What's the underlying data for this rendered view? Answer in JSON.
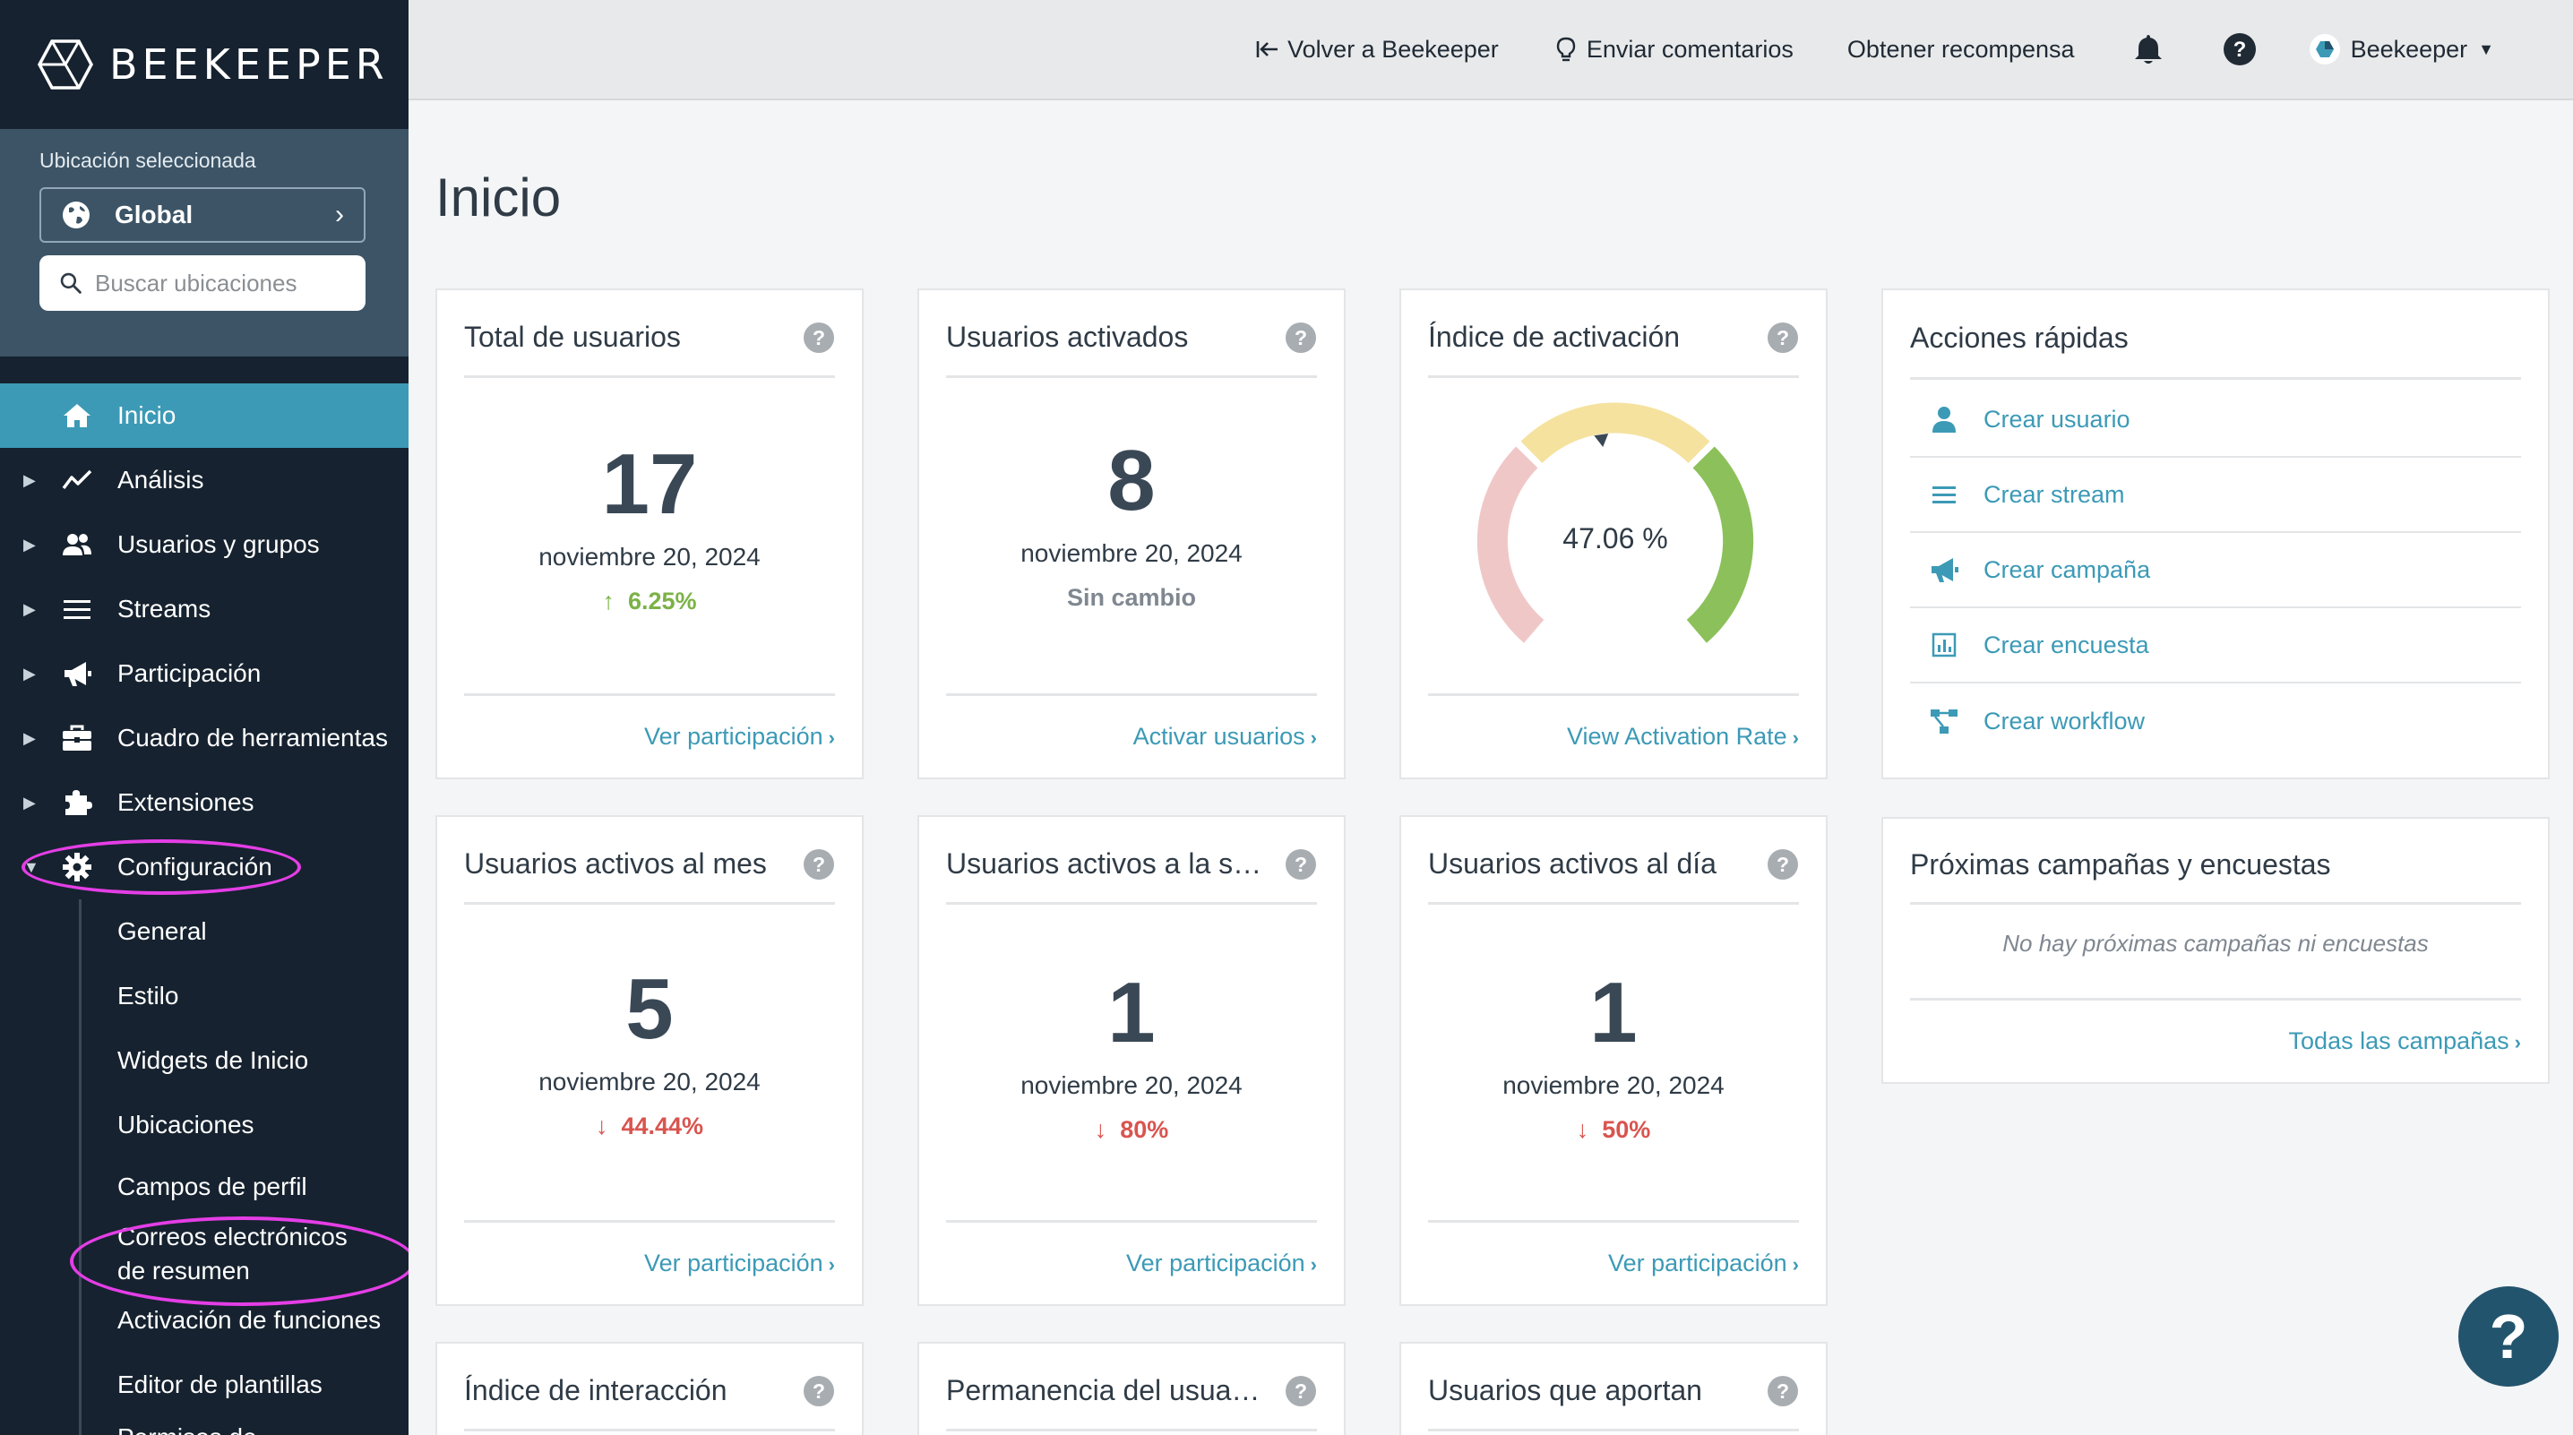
{
  "brand": {
    "name": "BEEKEEPER"
  },
  "location": {
    "label": "Ubicación seleccionada",
    "selected": "Global",
    "search_placeholder": "Buscar ubicaciones"
  },
  "nav": {
    "items": [
      {
        "label": "Inicio",
        "icon": "home-icon"
      },
      {
        "label": "Análisis",
        "icon": "chart-line-icon"
      },
      {
        "label": "Usuarios y grupos",
        "icon": "users-icon"
      },
      {
        "label": "Streams",
        "icon": "list-icon"
      },
      {
        "label": "Participación",
        "icon": "megaphone-icon"
      },
      {
        "label": "Cuadro de herramientas",
        "icon": "toolbox-icon"
      },
      {
        "label": "Extensiones",
        "icon": "puzzle-icon"
      },
      {
        "label": "Configuración",
        "icon": "gear-icon"
      }
    ],
    "sub_items": [
      "General",
      "Estilo",
      "Widgets de Inicio",
      "Ubicaciones",
      "Campos de perfil",
      "Correos electrónicos de resumen",
      "Activación de funciones",
      "Editor de plantillas",
      "Permisos de"
    ]
  },
  "topbar": {
    "back": "Volver a Beekeeper",
    "feedback": "Enviar comentarios",
    "reward": "Obtener recompensa",
    "user": "Beekeeper"
  },
  "page": {
    "title": "Inicio"
  },
  "cards": {
    "total_users": {
      "title": "Total de usuarios",
      "value": "17",
      "date": "noviembre 20, 2024",
      "delta": "6.25%",
      "link": "Ver participación"
    },
    "activated_users": {
      "title": "Usuarios activados",
      "value": "8",
      "date": "noviembre 20, 2024",
      "delta": "Sin cambio",
      "link": "Activar usuarios"
    },
    "activation_rate": {
      "title": "Índice de activación",
      "value": "47.06 %",
      "fraction": 0.4706,
      "link": "View Activation Rate"
    },
    "monthly_active": {
      "title": "Usuarios activos al mes",
      "value": "5",
      "date": "noviembre 20, 2024",
      "delta": "44.44%",
      "link": "Ver participación"
    },
    "weekly_active": {
      "title": "Usuarios activos a la s…",
      "value": "1",
      "date": "noviembre 20, 2024",
      "delta": "80%",
      "link": "Ver participación"
    },
    "daily_active": {
      "title": "Usuarios activos al día",
      "value": "1",
      "date": "noviembre 20, 2024",
      "delta": "50%",
      "link": "Ver participación"
    },
    "interaction_rate": {
      "title": "Índice de interacción"
    },
    "retention": {
      "title": "Permanencia del usua…"
    },
    "contributors": {
      "title": "Usuarios que aportan"
    }
  },
  "quick_actions": {
    "title": "Acciones rápidas",
    "items": [
      {
        "label": "Crear usuario",
        "icon": "user-icon"
      },
      {
        "label": "Crear stream",
        "icon": "stream-icon"
      },
      {
        "label": "Crear campaña",
        "icon": "megaphone-icon"
      },
      {
        "label": "Crear encuesta",
        "icon": "survey-icon"
      },
      {
        "label": "Crear workflow",
        "icon": "workflow-icon"
      }
    ]
  },
  "campaigns": {
    "title": "Próximas campañas y encuestas",
    "empty": "No hay próximas campañas ni encuestas",
    "link": "Todas las campañas"
  },
  "colors": {
    "sidebar": "#16222f",
    "accent": "#3c9ab6",
    "positive": "#7bb246",
    "negative": "#d9544f",
    "highlight": "#e43ee6"
  }
}
